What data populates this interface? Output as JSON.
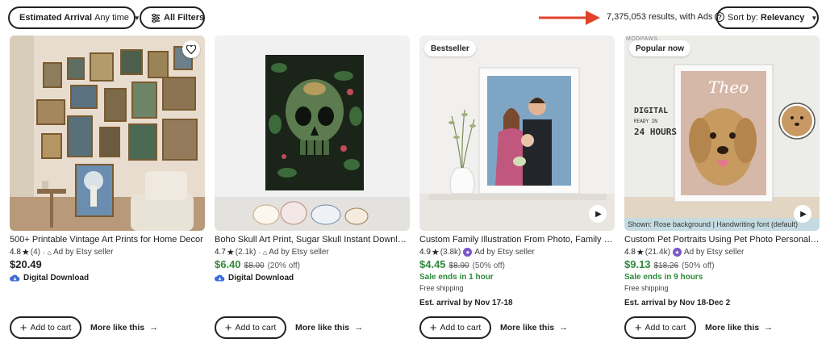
{
  "filters": {
    "arrival_label": "Estimated Arrival",
    "arrival_value": "Any time",
    "all_filters_label": "All Filters"
  },
  "results": {
    "count_text": "7,375,053 results, with Ads",
    "help_icon": "?"
  },
  "sort": {
    "label": "Sort by:",
    "value": "Relevancy"
  },
  "colors": {
    "accent_red": "#e2412b",
    "sale_green": "#2f8a3a",
    "star_seller_purple": "#7b55c7",
    "digital_cloud_blue": "#3d6bd6"
  },
  "cards": [
    {
      "title": "500+ Printable Vintage Art Prints for Home Decor",
      "rating": "4.8",
      "reviews": "(4)",
      "ad_text": "Ad by Etsy seller",
      "price": "$20.49",
      "digital": "Digital Download",
      "add_to_cart": "Add to cart",
      "more_like": "More like this"
    },
    {
      "title": "Boho Skull Art Print, Sugar Skull Instant Download",
      "rating": "4.7",
      "reviews": "(2.1k)",
      "ad_text": "Ad by Etsy seller",
      "price": "$6.40",
      "original_price": "$8.00",
      "discount": "(20% off)",
      "digital": "Digital Download",
      "add_to_cart": "Add to cart",
      "more_like": "More like this"
    },
    {
      "badge": "Bestseller",
      "title": "Custom Family Illustration From Photo, Family Portrait",
      "rating": "4.9",
      "reviews": "(3.8k)",
      "ad_text": "Ad by Etsy seller",
      "price": "$4.45",
      "original_price": "$8.90",
      "discount": "(50% off)",
      "sale_ends": "Sale ends in 1 hour",
      "shipping": "Free shipping",
      "arrival": "Est. arrival by Nov 17-18",
      "add_to_cart": "Add to cart",
      "more_like": "More like this"
    },
    {
      "badge": "Popular now",
      "brand_mark": "MODPAWS",
      "image_name": "Theo",
      "image_text_1": "DIGITAL",
      "image_text_2": "READY IN",
      "image_text_3": "24 HOURS",
      "caption": "Shown: Rose background | Handwriting font (default)",
      "title": "Custom Pet Portraits Using Pet Photo Personalized",
      "rating": "4.8",
      "reviews": "(21.4k)",
      "ad_text": "Ad by Etsy seller",
      "price": "$9.13",
      "original_price": "$18.26",
      "discount": "(50% off)",
      "sale_ends": "Sale ends in 9 hours",
      "shipping": "Free shipping",
      "arrival": "Est. arrival by Nov 18-Dec 2",
      "add_to_cart": "Add to cart",
      "more_like": "More like this"
    }
  ]
}
